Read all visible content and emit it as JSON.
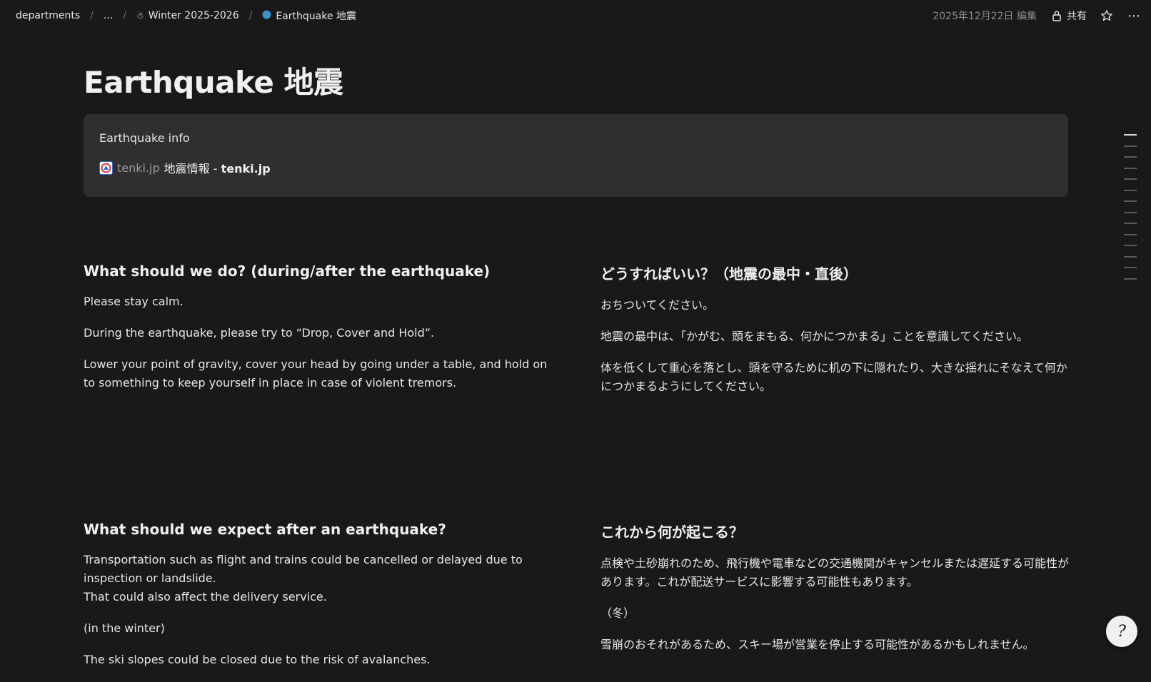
{
  "breadcrumb": {
    "items": [
      {
        "label": "departments"
      },
      {
        "label": "..."
      },
      {
        "label": "Winter 2025-2026",
        "icon": "snowman-icon"
      },
      {
        "label": "Earthquake 地震",
        "icon": "globe-icon"
      }
    ]
  },
  "topbar": {
    "edited": "2025年12月22日 編集",
    "share_label": "共有"
  },
  "page": {
    "title": "Earthquake 地震",
    "callout": {
      "title": "Earthquake info",
      "bookmark": {
        "domain": "tenki.jp",
        "title_prefix": "地震情報 - ",
        "title_bold": "tenki.jp"
      }
    },
    "sections": [
      {
        "en": {
          "heading": "What should we do? (during/after the earthquake)",
          "paragraphs": [
            "Please stay calm.",
            "During the earthquake, please try to “Drop, Cover and Hold”.",
            "Lower your point of gravity, cover your head by going under a table, and hold on to something to keep yourself in place in case of violent tremors."
          ]
        },
        "ja": {
          "heading": "どうすればいい？（地震の最中・直後）",
          "paragraphs": [
            "おちついてください。",
            "地震の最中は、「かがむ、頭をまもる、何かにつかまる」ことを意識してください。",
            "体を低くして重心を落とし、頭を守るために机の下に隠れたり、大きな揺れにそなえて何かにつかまるようにしてください。"
          ]
        }
      },
      {
        "en": {
          "heading": "What should we expect after an earthquake?",
          "paragraphs": [
            "Transportation such as flight and trains could be cancelled or delayed due to inspection or landslide.\nThat could also affect the delivery service.",
            "(in the winter)",
            "The ski slopes could be closed due to the risk of avalanches."
          ]
        },
        "ja": {
          "heading": "これから何が起こる？",
          "paragraphs": [
            "点検や土砂崩れのため、飛行機や電車などの交通機関がキャンセルまたは遅延する可能性があります。これが配送サービスに影響する可能性もあります。",
            "（冬）",
            "雪崩のおそれがあるため、スキー場が営業を停止する可能性があるかもしれません。"
          ]
        }
      }
    ]
  },
  "help_button": {
    "label": "?",
    "icon": "help-icon"
  }
}
